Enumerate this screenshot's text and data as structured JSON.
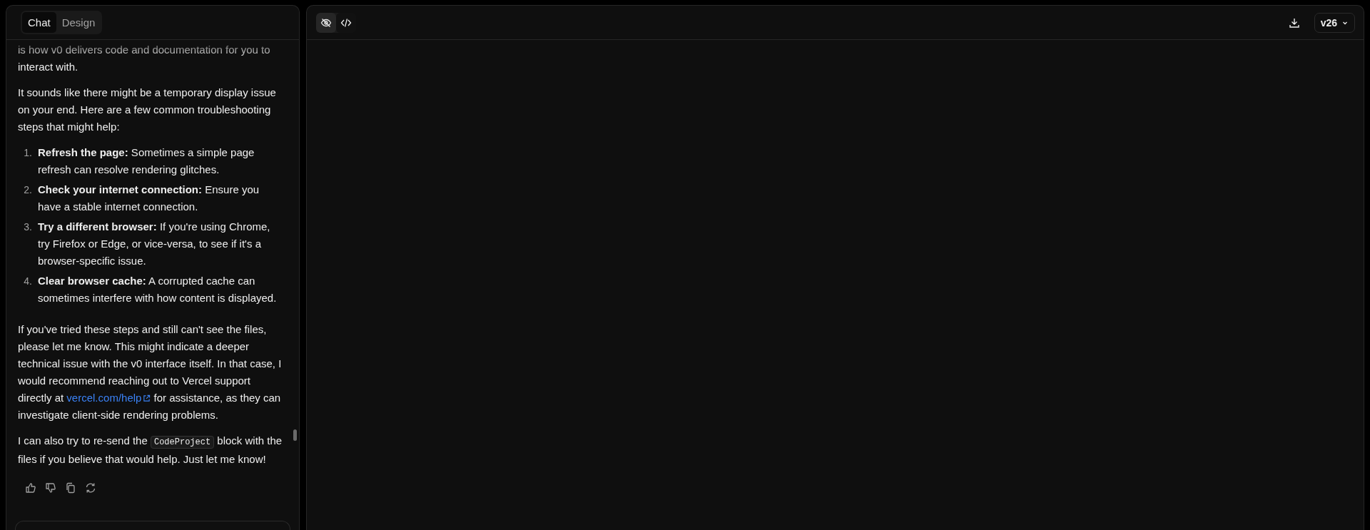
{
  "chat_panel": {
    "tabs": [
      {
        "label": "Chat",
        "selected": true
      },
      {
        "label": "Design",
        "selected": false
      }
    ],
    "messages": [
      {
        "kind": "paragraph",
        "text": "is how v0 delivers code and documentation for you to interact with."
      },
      {
        "kind": "paragraph",
        "text": "It sounds like there might be a temporary display issue on your end. Here are a few common troubleshooting steps that might help:"
      },
      {
        "kind": "list",
        "items": [
          {
            "number": "1.",
            "text": "**Refresh the page:** Sometimes a simple page refresh can resolve rendering glitches."
          },
          {
            "number": "2.",
            "text": "**Check your internet connection:** Ensure you have a stable internet connection."
          },
          {
            "number": "3.",
            "text": "**Try a different browser:** If you're using Chrome, try Firefox or Edge, or vice-versa, to see if it's a browser-specific issue."
          },
          {
            "number": "4.",
            "text": "**Clear browser cache:** A corrupted cache can sometimes interfere with how content is displayed."
          }
        ]
      },
      {
        "kind": "link_paragraph",
        "before": "If you've tried these steps and still can't see the files, please let me know. This might indicate a deeper technical issue with the v0 interface itself. In that case, I would recommend reaching out to Vercel support directly at",
        "link": "vercel.com/help",
        "after": "for assistance, as they can investigate client-side rendering problems."
      },
      {
        "kind": "code_paragraph",
        "before": "I can also try to re-send the",
        "code": "CodeProject",
        "after": "block with the files if you believe that would help. Just let me know!"
      }
    ]
  },
  "preview_panel": {
    "view_toggles": [
      {
        "kind": "preview",
        "selected": true
      },
      {
        "kind": "code",
        "selected": false
      }
    ],
    "version": "v26"
  }
}
